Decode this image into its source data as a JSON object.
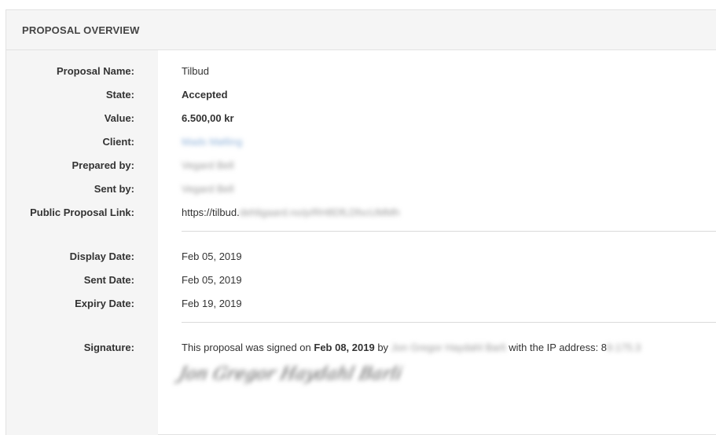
{
  "header": {
    "title": "PROPOSAL OVERVIEW"
  },
  "fields": {
    "proposal_name": {
      "label": "Proposal Name:",
      "value": "Tilbud"
    },
    "state": {
      "label": "State:",
      "value": "Accepted"
    },
    "value": {
      "label": "Value:",
      "value": "6.500,00 kr"
    },
    "client": {
      "label": "Client:",
      "value": "Mads Mølling"
    },
    "prepared_by": {
      "label": "Prepared by:",
      "value": "Vegard Bell"
    },
    "sent_by": {
      "label": "Sent by:",
      "value": "Vegard Bell"
    },
    "public_link": {
      "label": "Public Proposal Link:",
      "value_prefix": "https://tilbud.",
      "value_redacted": "dehligaard.no/p/RH8DfLDfxcUMMh"
    },
    "display_date": {
      "label": "Display Date:",
      "value": "Feb 05, 2019"
    },
    "sent_date": {
      "label": "Sent Date:",
      "value": "Feb 05, 2019"
    },
    "expiry_date": {
      "label": "Expiry Date:",
      "value": "Feb 19, 2019"
    },
    "signature": {
      "label": "Signature:",
      "text_before": "This proposal was signed on ",
      "date": "Feb 08, 2019",
      "text_by": " by ",
      "signer_redacted": "Jon Gregor Haydahl Barli",
      "text_ip": " with the IP address: 8",
      "ip_redacted": "9.175.3",
      "signature_script": "Jon Gregor Haydahl Barli"
    }
  }
}
